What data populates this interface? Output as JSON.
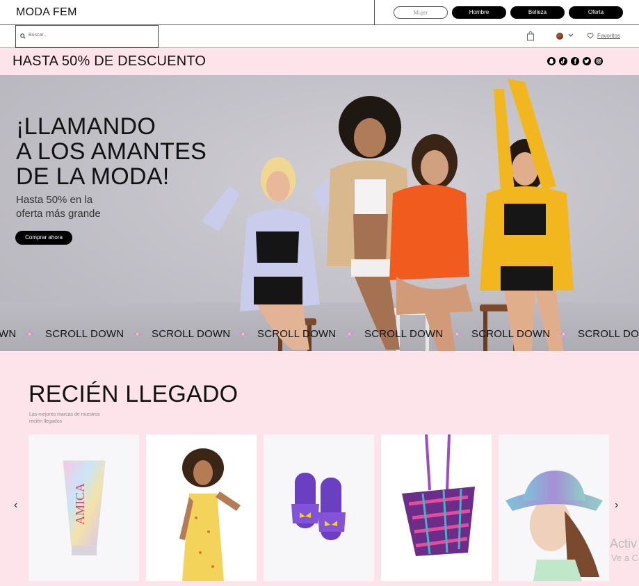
{
  "brand": "MODA FEM",
  "categories": [
    {
      "label": "Mujer"
    },
    {
      "label": "Hombre"
    },
    {
      "label": "Belleza"
    },
    {
      "label": "Oferta"
    }
  ],
  "search": {
    "placeholder": "Buscar..."
  },
  "favorites": "Favoritos",
  "promo": "HASTA 50% DE DESCUENTO",
  "social_icons": [
    "snapchat-icon",
    "tiktok-icon",
    "facebook-icon",
    "twitter-icon",
    "instagram-icon"
  ],
  "hero": {
    "line1": "¡LLAMANDO",
    "line2": "A LOS AMANTES",
    "line3": "DE LA MODA!",
    "sub1": "Hasta 50% en la",
    "sub2": "oferta más grande",
    "cta": "Comprar ahora"
  },
  "marquee": {
    "start": "WN",
    "text": "SCROLL DOWN",
    "end": "SCROLL DOW"
  },
  "new_arrivals": {
    "title": "RECIÉN LLEGADO",
    "subtitle": "Las mejores marcas de nuestros recién llegados",
    "prev": "‹",
    "next": "›",
    "products": [
      {
        "name": "tube-product"
      },
      {
        "name": "yellow-dress-product"
      },
      {
        "name": "purple-slides-product"
      },
      {
        "name": "woven-bag-product"
      },
      {
        "name": "bucket-hat-product"
      }
    ]
  },
  "tube_brand": "AMICA",
  "watermark": {
    "line1": "Activ",
    "line2": "Ve a C"
  },
  "colors": {
    "accent": "#000000",
    "promo_bg": "#fde3ea"
  }
}
